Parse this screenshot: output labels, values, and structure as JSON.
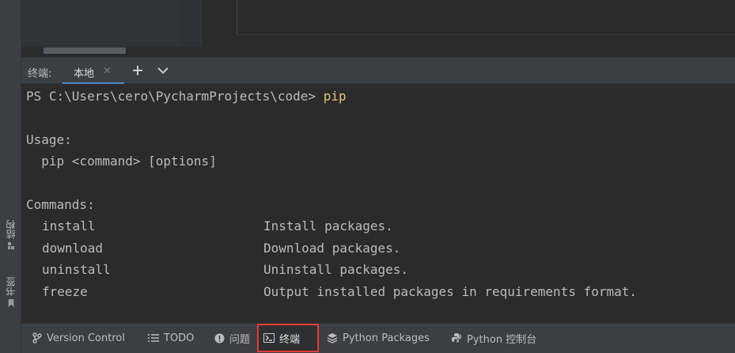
{
  "left_strip": {
    "structure_label": "结构",
    "bookmarks_label": "书签"
  },
  "terminal": {
    "title": "终端:",
    "tab_label": "本地",
    "tab_close": "×",
    "lines": {
      "prompt": "PS C:\\Users\\cero\\PycharmProjects\\code> ",
      "prompt_cmd": "pip",
      "usage_header": "Usage:",
      "usage_line": "  pip <command> [options]",
      "commands_header": "Commands:"
    },
    "commands": [
      {
        "name": "install",
        "desc": "Install packages."
      },
      {
        "name": "download",
        "desc": "Download packages."
      },
      {
        "name": "uninstall",
        "desc": "Uninstall packages."
      },
      {
        "name": "freeze",
        "desc": "Output installed packages in requirements format."
      }
    ]
  },
  "bottom_tools": {
    "version_control": "Version Control",
    "todo": "TODO",
    "problems": "问题",
    "terminal": "终端",
    "python_packages": "Python Packages",
    "python_console": "Python 控制台"
  },
  "colors": {
    "background": "#2b2b2b",
    "panel": "#3c3f41",
    "accent": "#4a88c7",
    "command_highlight": "#e5c07b",
    "active_outline": "#e53935"
  },
  "icons": {
    "add": "plus-icon",
    "dropdown": "chevron-down-icon",
    "vcs": "branch-icon",
    "todo": "list-icon",
    "problems": "info-icon",
    "terminal": "terminal-icon",
    "packages": "layers-icon",
    "console": "python-icon"
  }
}
